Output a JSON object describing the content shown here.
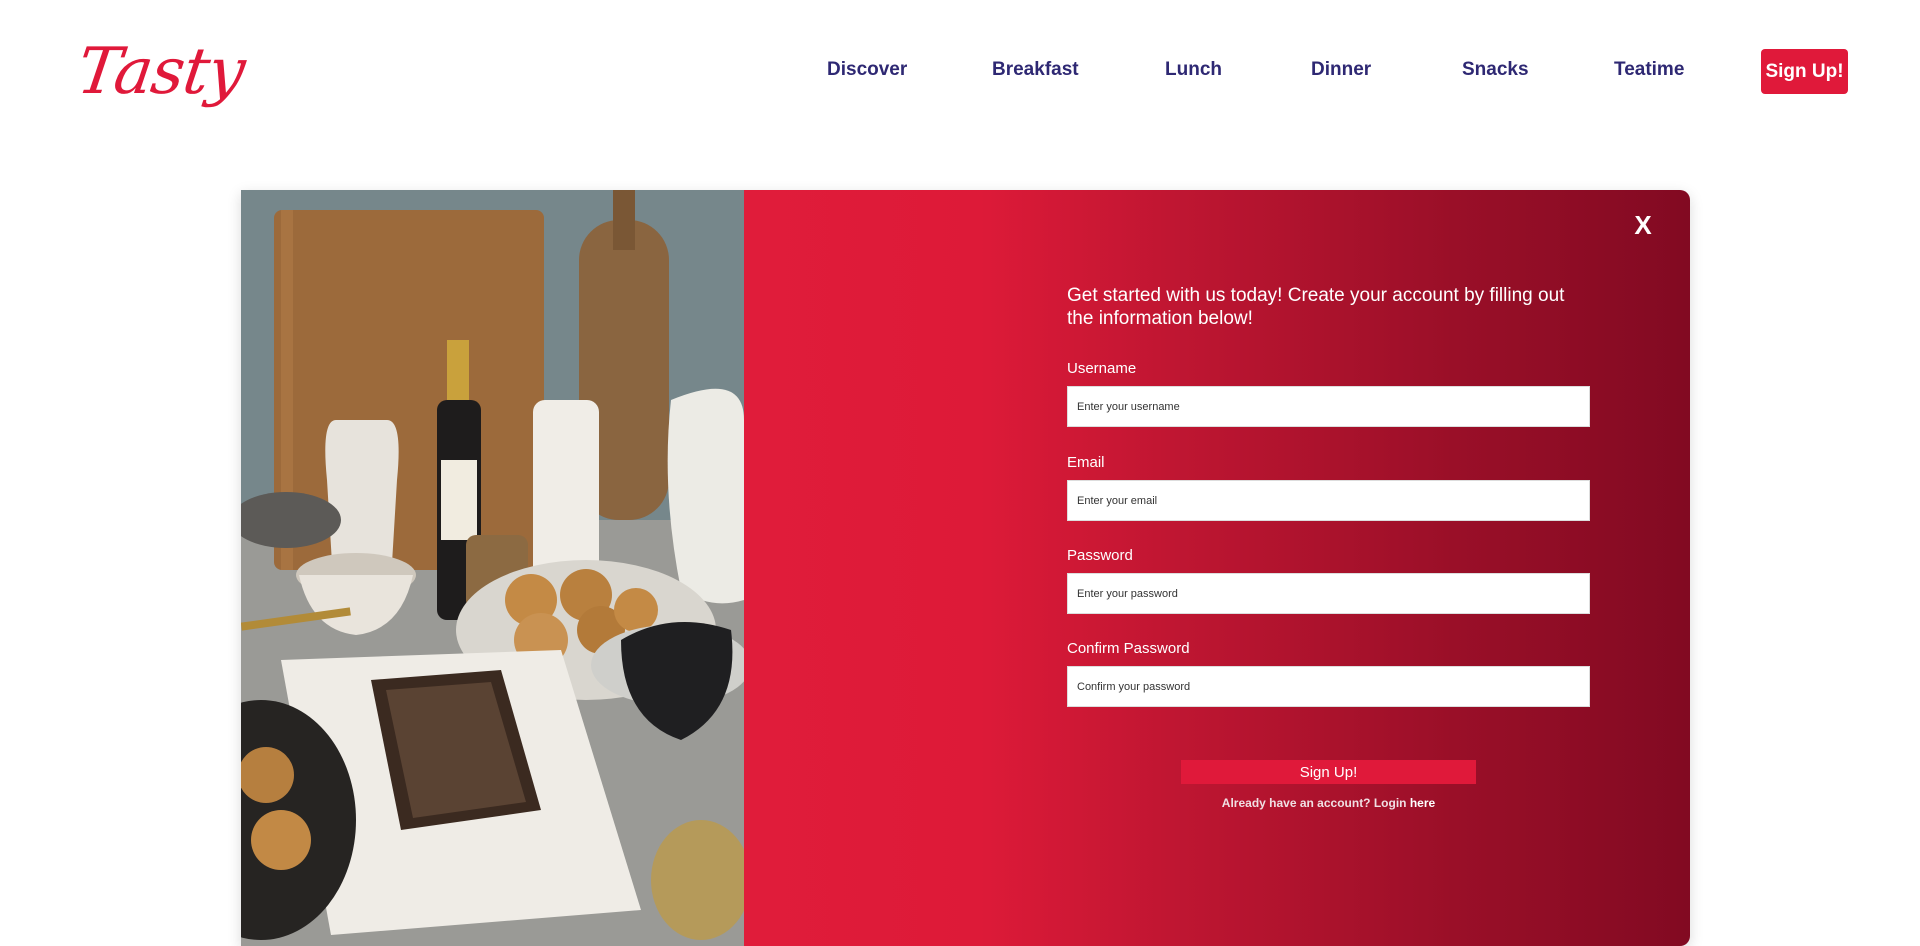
{
  "brand": {
    "logo_text": "Tasty",
    "accent_color": "#e0193a",
    "nav_color": "#2e2873"
  },
  "nav": {
    "items": [
      {
        "label": "Discover"
      },
      {
        "label": "Breakfast"
      },
      {
        "label": "Lunch"
      },
      {
        "label": "Dinner"
      },
      {
        "label": "Snacks"
      },
      {
        "label": "Teatime"
      }
    ],
    "signup_label": "Sign Up!"
  },
  "modal": {
    "close_label": "X",
    "intro": "Get started with us today! Create your account by filling out the information below!",
    "fields": [
      {
        "label": "Username",
        "placeholder": "Enter your username",
        "value": ""
      },
      {
        "label": "Email",
        "placeholder": "Enter your email",
        "value": ""
      },
      {
        "label": "Password",
        "placeholder": "Enter your password",
        "value": ""
      },
      {
        "label": "Confirm Password",
        "placeholder": "Confirm your password",
        "value": ""
      }
    ],
    "submit_label": "Sign Up!",
    "login_prompt": "Already have an account? Login ",
    "login_link": "here",
    "image_icon": "kitchen-photo"
  }
}
